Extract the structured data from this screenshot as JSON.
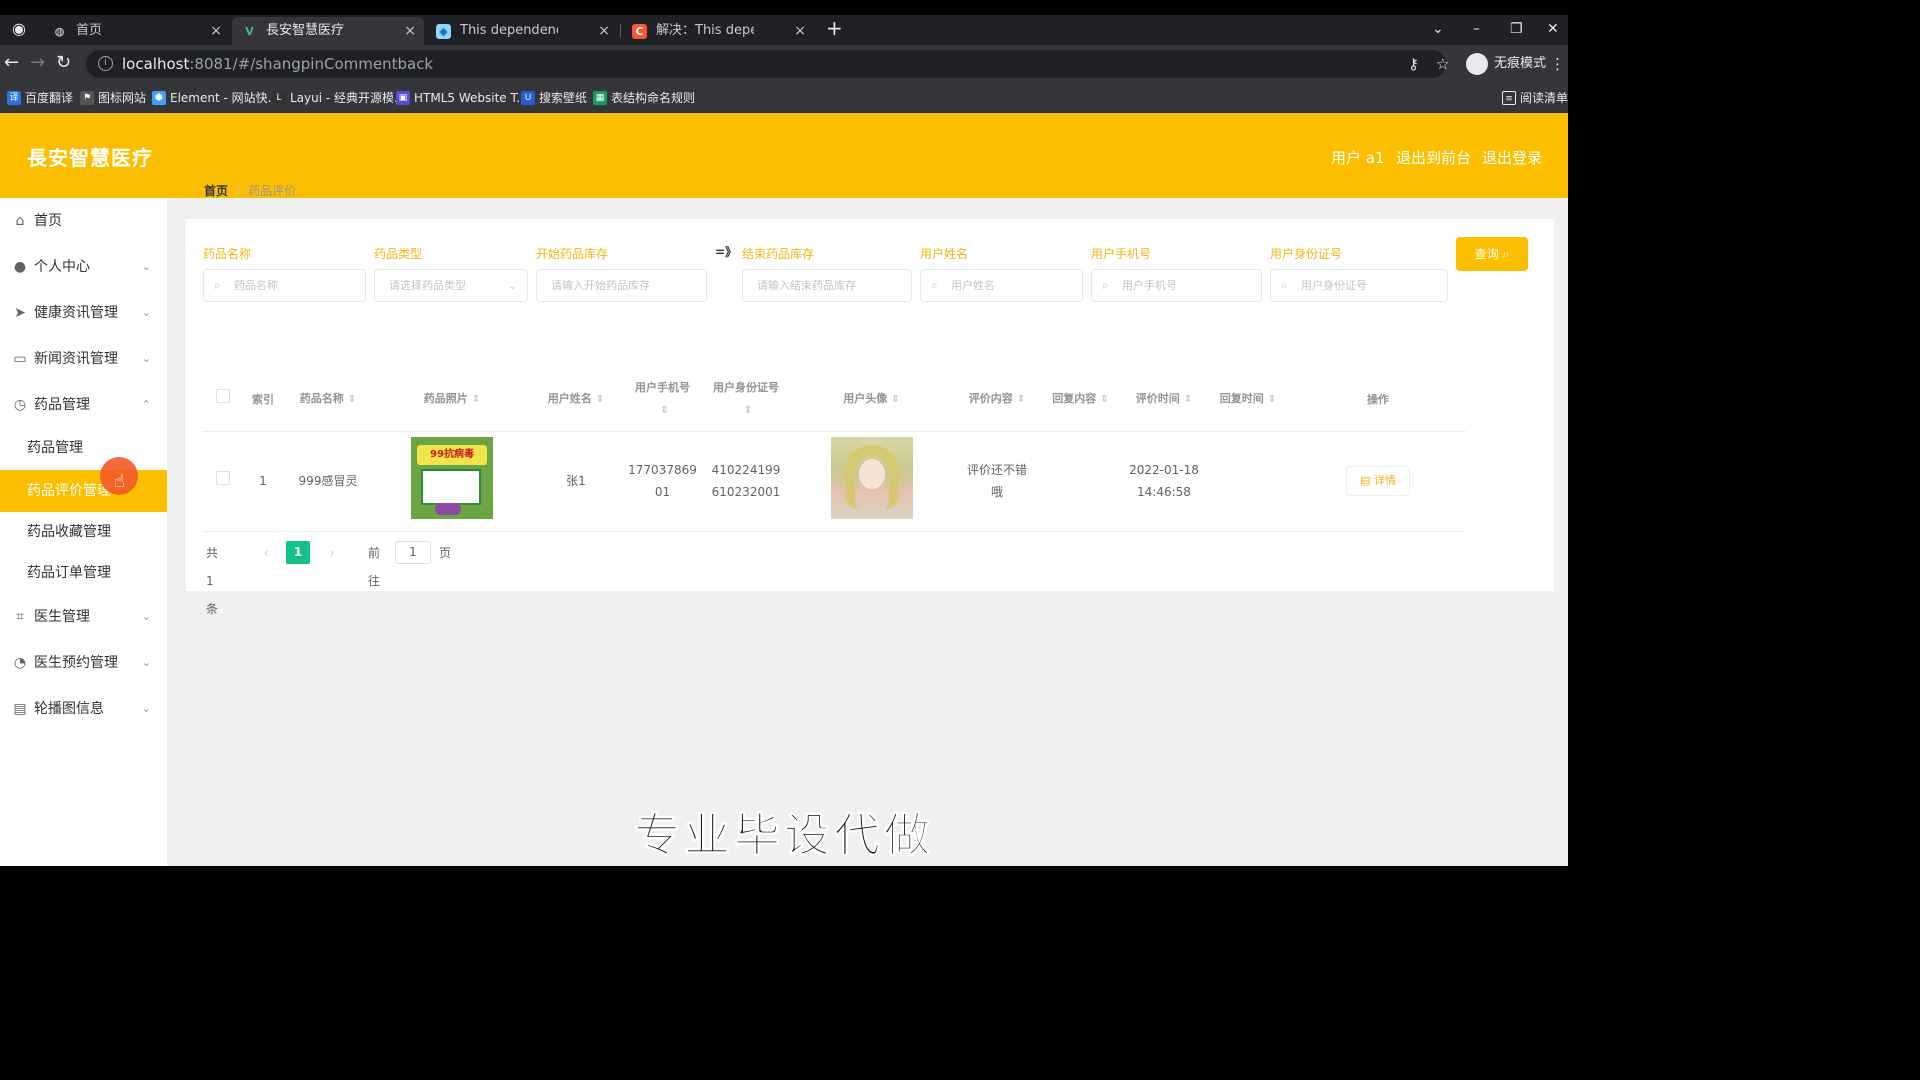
{
  "browser": {
    "tabs": [
      {
        "title": "首页",
        "icon": "globe-icon"
      },
      {
        "title": "長安智慧医疗",
        "icon": "vue-icon"
      },
      {
        "title": "This dependency was not foun",
        "icon": "webpack-icon"
      },
      {
        "title": "解决：This dependency was n",
        "icon": "csdn-icon"
      }
    ],
    "url_host": "localhost",
    "url_path": ":8081/#/shangpinCommentback",
    "incognito_label": "无痕模式",
    "bookmarks": [
      {
        "label": "百度翻译",
        "color": "#2d6fe0"
      },
      {
        "label": "图标网站",
        "color": "#555555"
      },
      {
        "label": "Element - 网站快...",
        "color": "#409eff"
      },
      {
        "label": "Layui - 经典开源模...",
        "color": "#333333"
      },
      {
        "label": "HTML5 Website T...",
        "color": "#5b4bd6"
      },
      {
        "label": "搜索壁纸",
        "color": "#2a5bd7"
      },
      {
        "label": "表结构命名规则",
        "color": "#16a05d"
      }
    ],
    "reading_list": "阅读清单"
  },
  "header": {
    "title": "長安智慧医疗",
    "user": "用户 a1",
    "back_to_front": "退出到前台",
    "logout": "退出登录",
    "brand_color": "#fbbf00"
  },
  "sidebar": {
    "items": [
      {
        "label": "首页",
        "icon": "home-icon",
        "expandable": false
      },
      {
        "label": "个人中心",
        "icon": "user-icon",
        "expandable": true
      },
      {
        "label": "健康资讯管理",
        "icon": "send-icon",
        "expandable": true
      },
      {
        "label": "新闻资讯管理",
        "icon": "bank-icon",
        "expandable": true
      },
      {
        "label": "药品管理",
        "icon": "clock-icon",
        "expandable": true,
        "expanded": true
      }
    ],
    "sub_items": [
      {
        "label": "药品管理",
        "active": false
      },
      {
        "label": "药品评价管理",
        "active": true
      },
      {
        "label": "药品收藏管理",
        "active": false
      },
      {
        "label": "药品订单管理",
        "active": false
      }
    ],
    "items_after": [
      {
        "label": "医生管理",
        "icon": "crop-icon",
        "expandable": true
      },
      {
        "label": "医生预约管理",
        "icon": "dashboard-icon",
        "expandable": true
      },
      {
        "label": "轮播图信息",
        "icon": "picture-icon",
        "expandable": true
      }
    ]
  },
  "breadcrumb": {
    "home": "首页",
    "current": "药品评价"
  },
  "filters": {
    "drug_name": {
      "label": "药品名称",
      "placeholder": "药品名称"
    },
    "drug_type": {
      "label": "药品类型",
      "placeholder": "请选择药品类型"
    },
    "stock_start": {
      "label": "开始药品库存",
      "placeholder": "请输入开始药品库存"
    },
    "range_arrow": "=》",
    "stock_end": {
      "label": "结束药品库存",
      "placeholder": "请输入结束药品库存"
    },
    "user_name": {
      "label": "用户姓名",
      "placeholder": "用户姓名"
    },
    "user_phone": {
      "label": "用户手机号",
      "placeholder": "用户手机号"
    },
    "user_id_card": {
      "label": "用户身份证号",
      "placeholder": "用户身份证号"
    },
    "search_button": "查询"
  },
  "table": {
    "columns": [
      "索引",
      "药品名称",
      "药品照片",
      "用户姓名",
      "用户手机号",
      "用户身份证号",
      "用户头像",
      "评价内容",
      "回复内容",
      "评价时间",
      "回复时间",
      "操作"
    ],
    "rows": [
      {
        "index": "1",
        "drug_name": "999感冒灵",
        "drug_photo_text": "99抗病毒",
        "user_name": "张1",
        "phone_line1": "177037869",
        "phone_line2": "01",
        "id_line1": "410224199",
        "id_line2": "610232001",
        "comment_line1": "评价还不错",
        "comment_line2": "哦",
        "reply": "",
        "time_line1": "2022-01-18",
        "time_line2": "14:46:58",
        "reply_time": "",
        "detail_button": "详情"
      }
    ]
  },
  "pagination": {
    "total_label": "共 1 条",
    "current_page": "1",
    "goto_label": "前往",
    "goto_value": "1",
    "page_unit": "页",
    "active_color": "#13c287"
  },
  "overlay_caption": "专业毕设代做"
}
